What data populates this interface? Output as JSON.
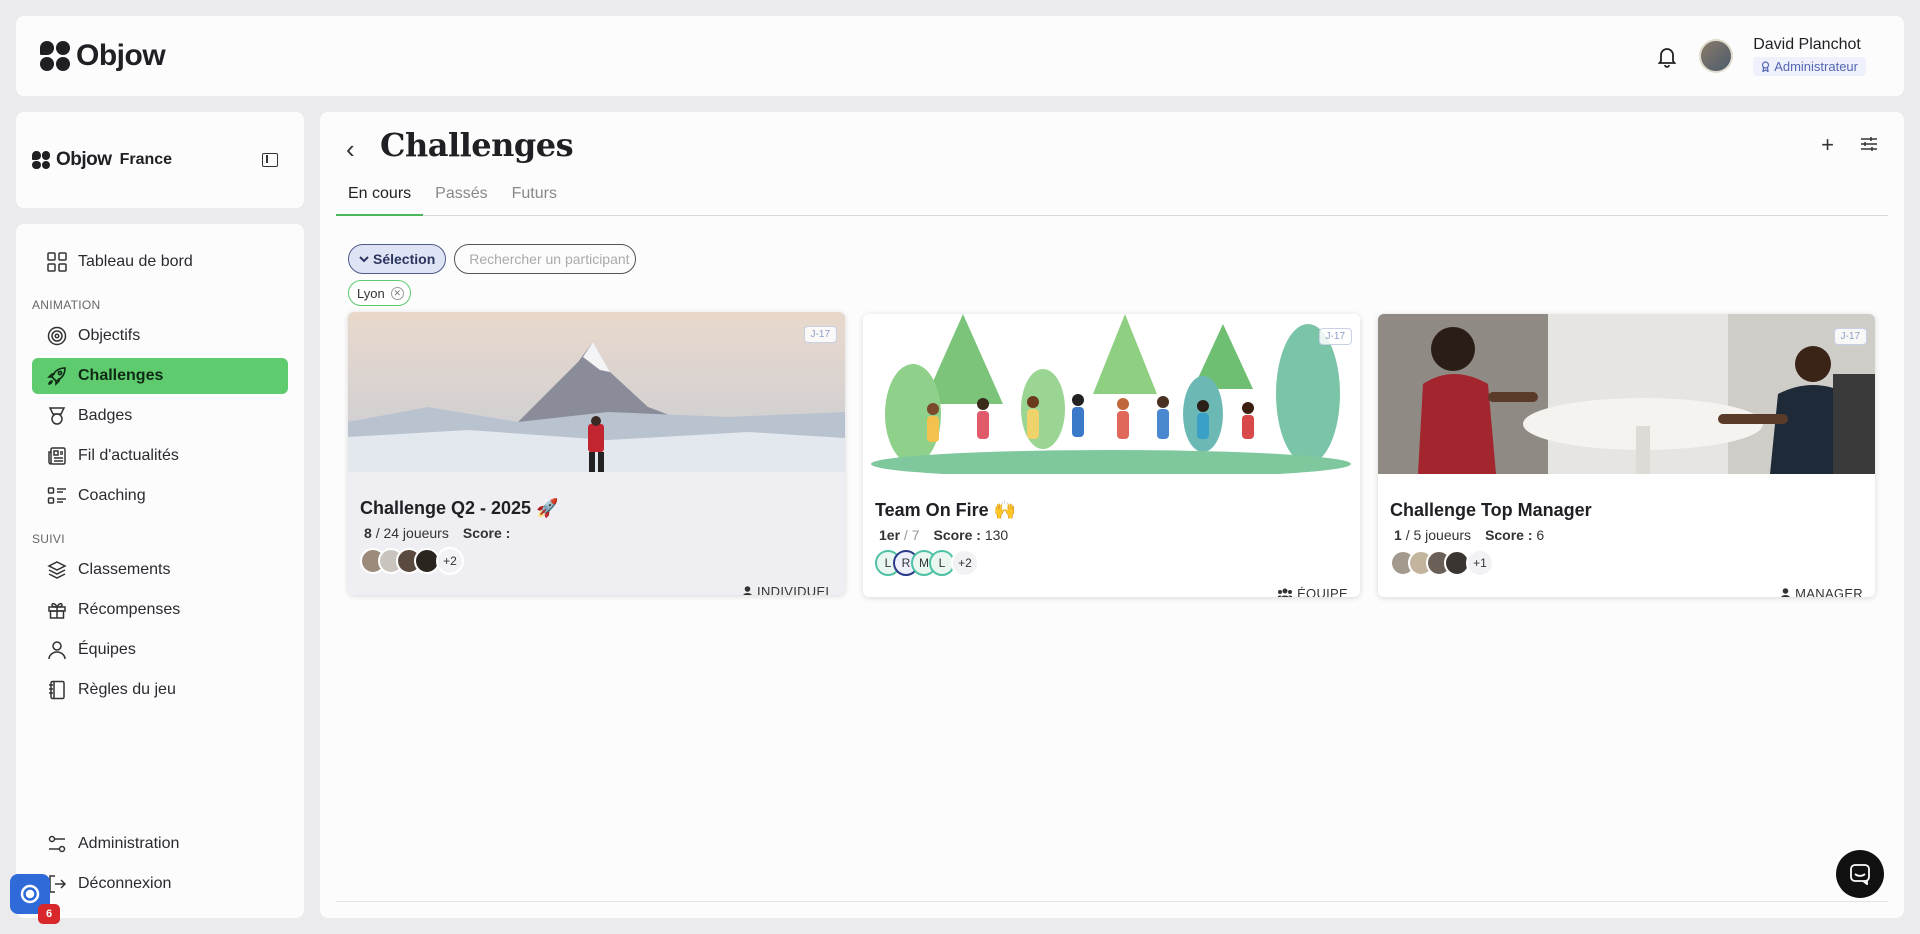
{
  "app": {
    "name": "Objow",
    "org": "France"
  },
  "user": {
    "name": "David Planchot",
    "role": "Administrateur"
  },
  "nav": {
    "dashboard": "Tableau de bord",
    "section_animation": "ANIMATION",
    "items_animation": [
      "Objectifs",
      "Challenges",
      "Badges",
      "Fil d'actualités",
      "Coaching"
    ],
    "section_suivi": "SUIVI",
    "items_suivi": [
      "Classements",
      "Récompenses",
      "Équipes",
      "Règles du jeu"
    ],
    "admin": "Administration",
    "logout": "Déconnexion",
    "active": "Challenges"
  },
  "page": {
    "title": "Challenges",
    "tabs": [
      "En cours",
      "Passés",
      "Futurs"
    ],
    "active_tab": "En cours"
  },
  "filters": {
    "selection_label": "Sélection",
    "search_placeholder": "Rechercher un participant",
    "chips": [
      "Lyon"
    ]
  },
  "cards": [
    {
      "title": "Challenge Q2 - 2025 🚀",
      "tag": "J-17",
      "rank": "8",
      "rank_suffix": "/ 24 joueurs",
      "score_label": "Score :",
      "score": "",
      "more": "+2",
      "type": "INDIVIDUEL"
    },
    {
      "title": "Team On Fire 🙌",
      "tag": "J-17",
      "rank": "1er",
      "rank_suffix": "/ 7",
      "score_label": "Score :",
      "score": "130",
      "more": "+2",
      "type": "ÉQUIPE",
      "team_initials": [
        "L",
        "R",
        "M",
        "L"
      ]
    },
    {
      "title": "Challenge Top Manager",
      "tag": "J-17",
      "rank": "1",
      "rank_suffix": "/ 5 joueurs",
      "score_label": "Score :",
      "score": "6",
      "more": "+1",
      "type": "MANAGER"
    }
  ],
  "help": {
    "badge_count": "6"
  },
  "colors": {
    "accent_green": "#5ecb6e",
    "role_blue": "#5567b5",
    "help_blue": "#2f6ad9",
    "alert_red": "#d8282b"
  }
}
